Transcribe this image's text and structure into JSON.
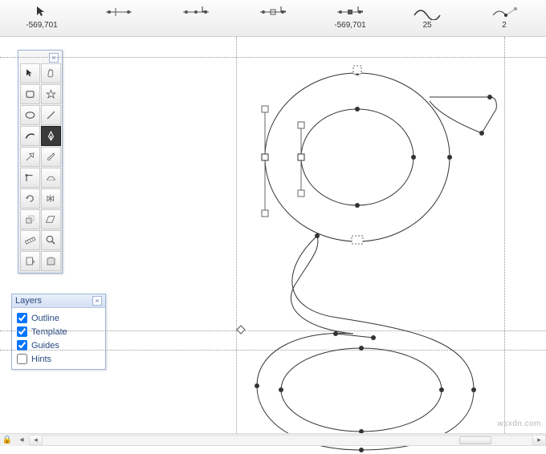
{
  "topbar": {
    "items": [
      {
        "label": "-569,701",
        "icon": "pointer"
      },
      {
        "label": "",
        "icon": "add-node"
      },
      {
        "label": "",
        "icon": "insert-node"
      },
      {
        "label": "",
        "icon": "convert-node"
      },
      {
        "label": "-569,701",
        "icon": "node-pos"
      },
      {
        "label": "25",
        "icon": "curve-tension"
      },
      {
        "label": "2",
        "icon": "curve-handles"
      }
    ]
  },
  "tools": [
    {
      "name": "selection-tool",
      "icon": "pointer",
      "active": false
    },
    {
      "name": "pan-tool",
      "icon": "hand",
      "active": false
    },
    {
      "name": "rect-tool",
      "icon": "rect",
      "active": false
    },
    {
      "name": "star-tool",
      "icon": "star",
      "active": false
    },
    {
      "name": "ellipse-tool",
      "icon": "ellipse",
      "active": false
    },
    {
      "name": "line-tool",
      "icon": "line",
      "active": false
    },
    {
      "name": "draw-tool",
      "icon": "stroke",
      "active": false
    },
    {
      "name": "pen-tool",
      "icon": "pen",
      "active": true
    },
    {
      "name": "knife-tool",
      "icon": "knife",
      "active": false
    },
    {
      "name": "brush-tool",
      "icon": "brush",
      "active": false
    },
    {
      "name": "corner-tool",
      "icon": "corner",
      "active": false
    },
    {
      "name": "tangent-tool",
      "icon": "tangent",
      "active": false
    },
    {
      "name": "rotate-tool",
      "icon": "rotate",
      "active": false
    },
    {
      "name": "mirror-tool",
      "icon": "mirror",
      "active": false
    },
    {
      "name": "scale-tool",
      "icon": "scale",
      "active": false
    },
    {
      "name": "skew-tool",
      "icon": "skew",
      "active": false
    },
    {
      "name": "measure-tool",
      "icon": "ruler",
      "active": false
    },
    {
      "name": "zoom-tool",
      "icon": "zoom",
      "active": false
    },
    {
      "name": "guide-tool",
      "icon": "guide",
      "active": false
    },
    {
      "name": "fill-tool",
      "icon": "fill",
      "active": false
    }
  ],
  "layers": {
    "title": "Layers",
    "items": [
      {
        "label": "Outline",
        "checked": true
      },
      {
        "label": "Template",
        "checked": true
      },
      {
        "label": "Guides",
        "checked": true
      },
      {
        "label": "Hints",
        "checked": false
      }
    ]
  },
  "guides": {
    "vertical": [
      294,
      628
    ],
    "horizontal": [
      25,
      366,
      390
    ]
  },
  "watermark": "wsxdn.com"
}
